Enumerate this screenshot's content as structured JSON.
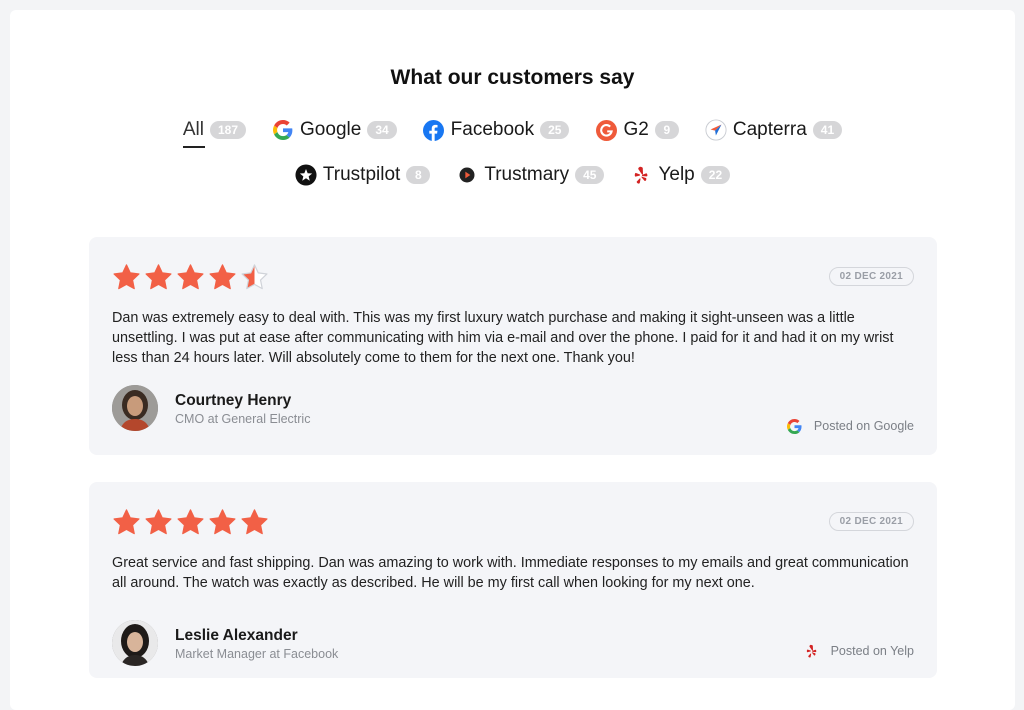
{
  "heading": "What our customers say",
  "tabs_row1": [
    {
      "label": "All",
      "count": "187",
      "icon": "none"
    },
    {
      "label": "Google",
      "count": "34",
      "icon": "google-icon"
    },
    {
      "label": "Facebook",
      "count": "25",
      "icon": "facebook-icon"
    },
    {
      "label": "G2",
      "count": "9",
      "icon": "g2-icon"
    },
    {
      "label": "Capterra",
      "count": "41",
      "icon": "capterra-icon"
    }
  ],
  "tabs_row2": [
    {
      "label": "Trustpilot",
      "count": "8",
      "icon": "trustpilot-icon"
    },
    {
      "label": "Trustmary",
      "count": "45",
      "icon": "trustmary-icon"
    },
    {
      "label": "Yelp",
      "count": "22",
      "icon": "yelp-icon"
    }
  ],
  "colors": {
    "star": "#f26046",
    "star_empty": "#d0d3d9",
    "google_blue": "#4285F4",
    "facebook": "#1877F2",
    "g2": "#ef5a3a",
    "yelp": "#d32323"
  },
  "reviews": [
    {
      "rating": 4.5,
      "date": "02 DEC 2021",
      "text": "Dan was extremely easy to deal with. This was my first luxury watch purchase and making it sight-unseen was a little unsettling. I was put at ease after communicating with him via e-mail and over the phone. I paid for it and had it on my wrist less than 24 hours later. Will absolutely come to them for the next one. Thank you!",
      "name": "Courtney Henry",
      "role": "CMO at General Electric",
      "posted": "Posted on Google",
      "source_icon": "google-icon"
    },
    {
      "rating": 5,
      "date": "02 DEC 2021",
      "text": "Great service and fast shipping. Dan was amazing to work with. Immediate responses to my emails and great communication all around. The watch was exactly as described. He will be my first call when looking for my next one.",
      "name": "Leslie Alexander",
      "role": "Market Manager at Facebook",
      "posted": "Posted on Yelp",
      "source_icon": "yelp-icon"
    }
  ]
}
